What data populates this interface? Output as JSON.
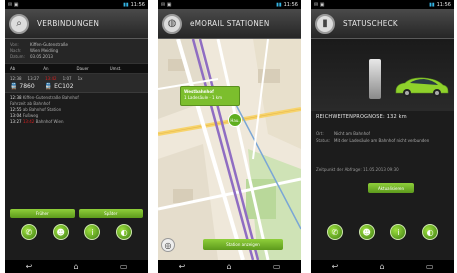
{
  "status_bar": {
    "left": "✉ ▣",
    "signal": "▮▮",
    "time": "11:56"
  },
  "nav_bar": {
    "back": "↩",
    "home": "⌂",
    "recent": "▭"
  },
  "panel1": {
    "title": "VERBINDUNGEN",
    "from_label": "Von:",
    "from_value": "Kiffen-Gutenstraße",
    "to_label": "Nach:",
    "to_value": "Wien Meidling",
    "date_label": "Datum:",
    "date_value": "03.05.2013",
    "col_ab": "Ab",
    "col_an": "An",
    "col_dauer": "Dauer",
    "col_umst": "Umst.",
    "conn_dep": "12:38",
    "conn_arr": "13:27",
    "conn_arr_late": "13:42",
    "conn_dur": "1:07",
    "conn_changes": "1x",
    "train1": "7860",
    "train2": "EC102",
    "d1_time": "12:38",
    "d1_text": "Kiffen-Gutenstraße Bahnhof",
    "d2_text": "Fahrzeit ab Bahnhof",
    "d3_time": "12:55",
    "d3_text": "ab Bahnhof Station",
    "d4_time": "13:04",
    "d4_text": "Fußweg",
    "d5_time": "13:27",
    "d5_late": "13:42",
    "d5_text": "Bahnhof Wien",
    "btn_left": "Früher",
    "btn_right": "Später",
    "icons": [
      "phone-icon",
      "user-icon",
      "info-icon",
      "toggle-icon"
    ]
  },
  "panel2": {
    "title": "eMORAIL STATIONEN",
    "bubble_name": "Westbahnhof",
    "bubble_sub": "1 Ladesäule · 1 km",
    "pin_label": "Hau.",
    "show_button": "Station anzeigen"
  },
  "panel3": {
    "title": "STATUSCHECK",
    "reach_label": "REICHWEITENPROGNOSE:",
    "reach_value": "132 km",
    "ort_label": "Ort:",
    "ort_value": "Nicht am Bahnhof",
    "status_label": "Status:",
    "status_value": "Mit der Ladesäule am Bahnhof nicht verbunden",
    "stamp": "Zeitpunkt der Abfrage: 11.05.2013 09:30",
    "update_button": "Aktualisieren",
    "icons": [
      "phone-icon",
      "user-icon",
      "info-icon",
      "toggle-icon"
    ]
  },
  "colors": {
    "accent_green": "#7cbe2d",
    "dark_bg": "#1c1c1c",
    "late_red": "#d32020"
  }
}
